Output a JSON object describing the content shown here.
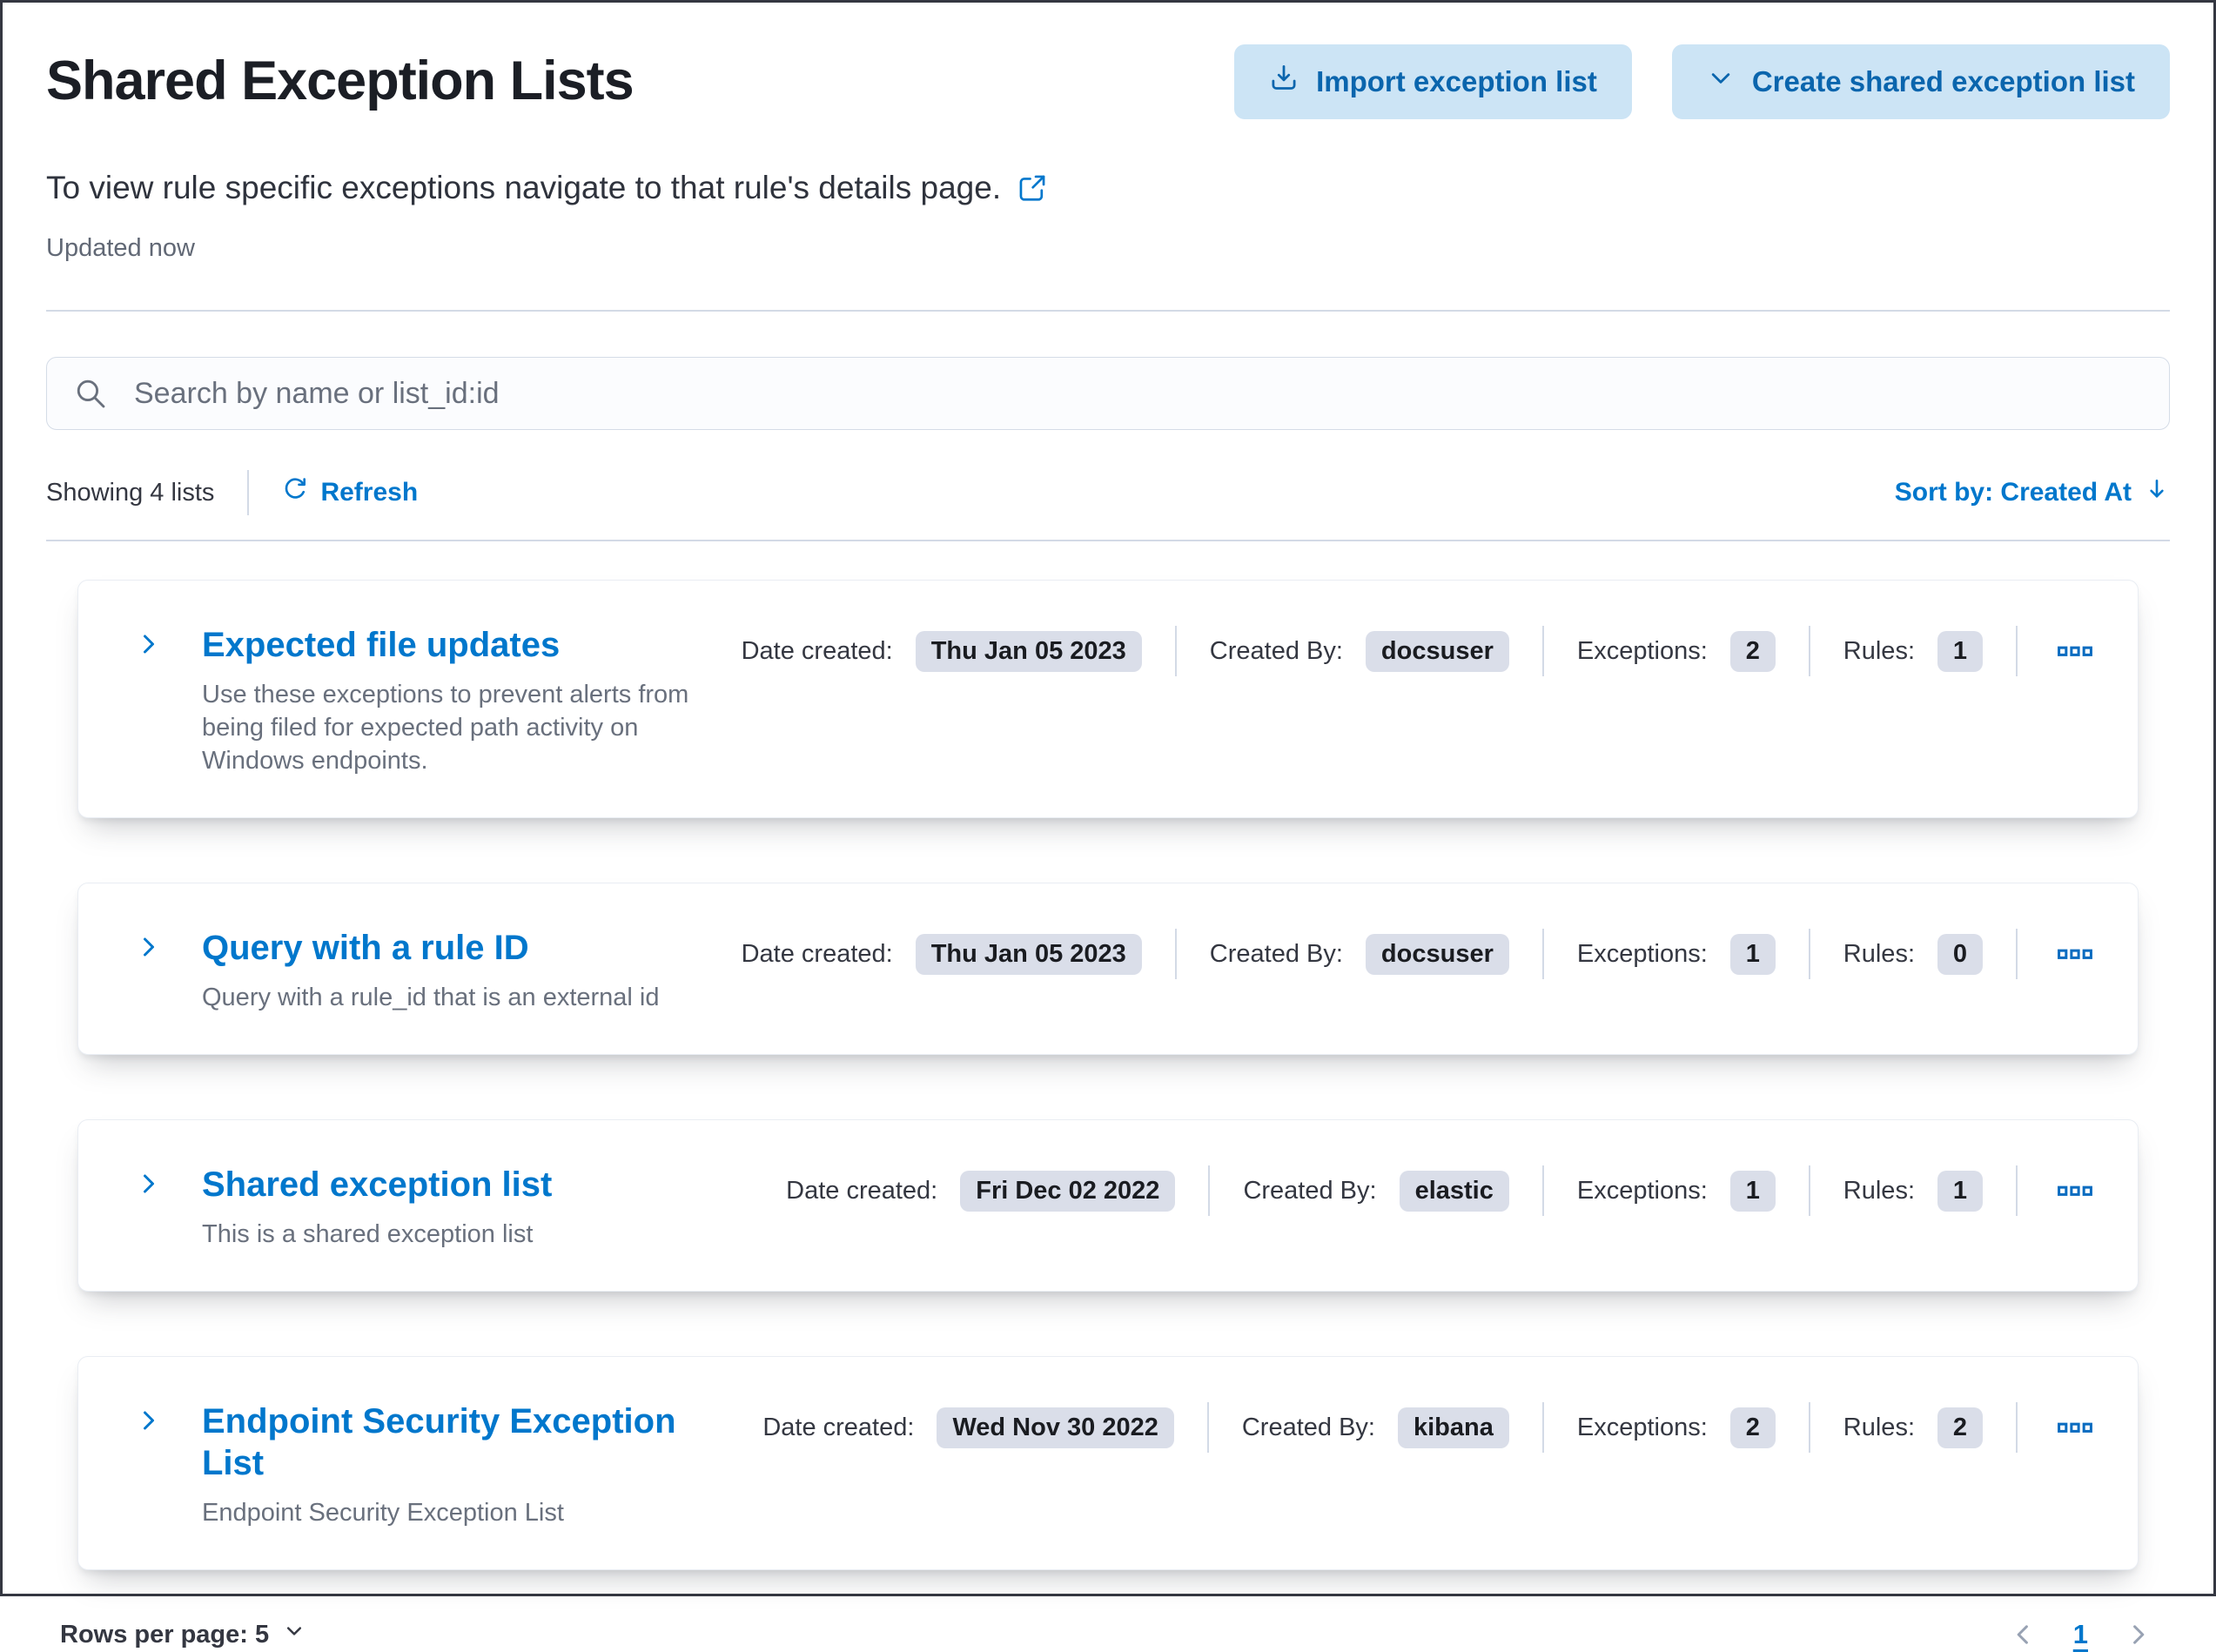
{
  "page": {
    "title": "Shared Exception Lists",
    "subtitle": "To view rule specific exceptions navigate to that rule's details page.",
    "updated": "Updated now"
  },
  "header_buttons": {
    "import_label": "Import exception list",
    "create_label": "Create shared exception list"
  },
  "search": {
    "placeholder": "Search by name or list_id:id"
  },
  "toolbar": {
    "showing": "Showing 4 lists",
    "refresh_label": "Refresh",
    "sort_label": "Sort by: Created At"
  },
  "meta_labels": {
    "date_created": "Date created:",
    "created_by": "Created By:",
    "exceptions": "Exceptions:",
    "rules": "Rules:"
  },
  "lists": [
    {
      "name": "Expected file updates",
      "description": "Use these exceptions to prevent alerts from being filed for expected path activity on Windows endpoints.",
      "date_created": "Thu Jan 05 2023",
      "created_by": "docsuser",
      "exceptions": "2",
      "rules": "1"
    },
    {
      "name": "Query with a rule ID",
      "description": "Query with a rule_id that is an external id",
      "date_created": "Thu Jan 05 2023",
      "created_by": "docsuser",
      "exceptions": "1",
      "rules": "0"
    },
    {
      "name": "Shared exception list",
      "description": "This is a shared exception list",
      "date_created": "Fri Dec 02 2022",
      "created_by": "elastic",
      "exceptions": "1",
      "rules": "1"
    },
    {
      "name": "Endpoint Security Exception List",
      "description": "Endpoint Security Exception List",
      "date_created": "Wed Nov 30 2022",
      "created_by": "kibana",
      "exceptions": "2",
      "rules": "2"
    }
  ],
  "footer": {
    "rows_per_page": "Rows per page: 5",
    "page_number": "1"
  },
  "icons": [
    "import-download-icon",
    "chevron-down-icon",
    "external-link-icon",
    "search-icon",
    "refresh-icon",
    "sort-down-icon",
    "chevron-right-icon",
    "boxes-horizontal-icon",
    "chevron-left-icon"
  ],
  "colors": {
    "primary_link": "#0077CC",
    "button_bg": "#CCE4F5",
    "button_text": "#0a65ad",
    "badge_bg": "#DADEE9",
    "divider": "#D3DAE6",
    "title_text": "#1b1e25",
    "body_text": "#343741",
    "subdued_text": "#69707D",
    "pagination_arrow": "#98A2B3"
  }
}
